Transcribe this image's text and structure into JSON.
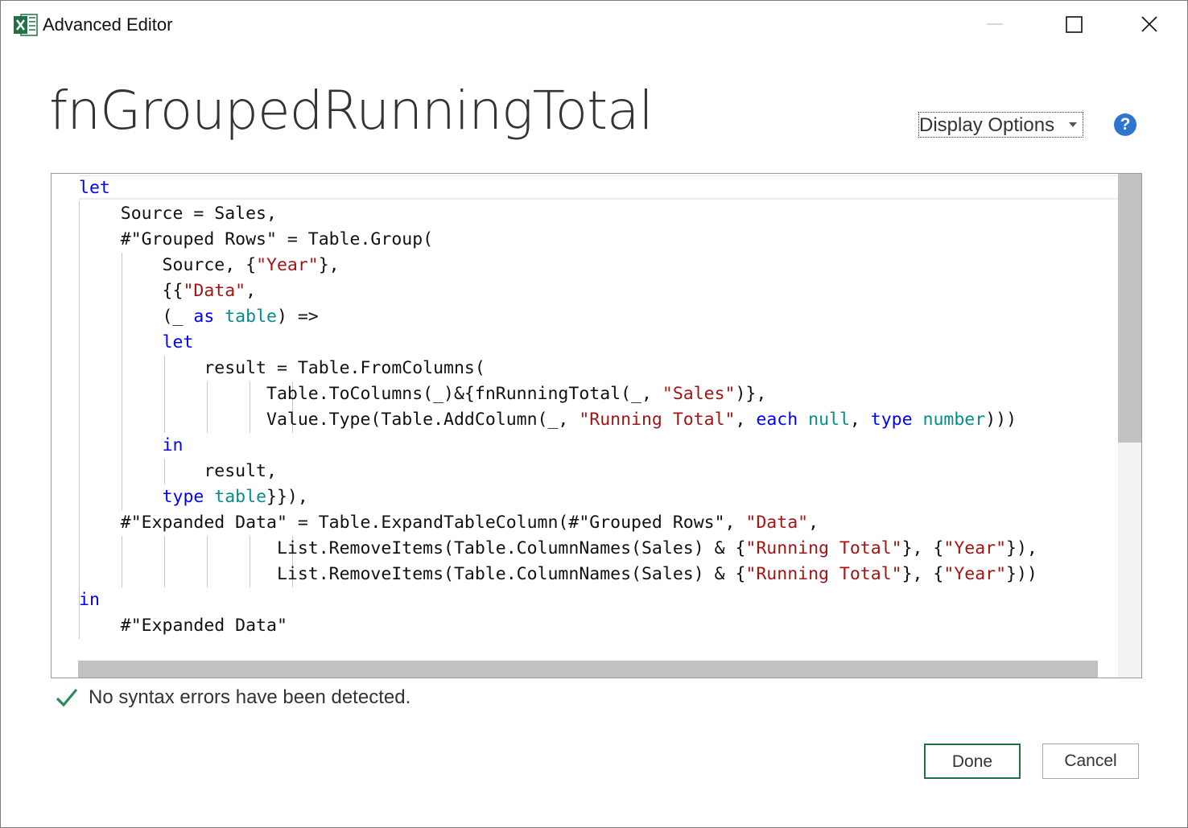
{
  "window": {
    "title": "Advanced Editor",
    "app_icon": "excel-icon",
    "controls": [
      "minimize-icon",
      "maximize-icon",
      "close-icon"
    ]
  },
  "query_name": "fnGroupedRunningTotal",
  "toolbar": {
    "display_options_label": "Display Options",
    "help_label": "?"
  },
  "colors": {
    "keyword": "#0000ff",
    "string": "#a31515",
    "type": "#098b8b",
    "done_border": "#217346",
    "success_check": "#2e8b57"
  },
  "code_lines": [
    [
      {
        "t": "let",
        "c": "kw"
      }
    ],
    [
      {
        "t": "    Source = Sales,"
      }
    ],
    [
      {
        "t": "    #\"Grouped Rows\" = Table.Group("
      }
    ],
    [
      {
        "t": "        Source, {"
      },
      {
        "t": "\"Year\"",
        "c": "st"
      },
      {
        "t": "},"
      }
    ],
    [
      {
        "t": "        {{"
      },
      {
        "t": "\"Data\"",
        "c": "st"
      },
      {
        "t": ","
      }
    ],
    [
      {
        "t": "        (_ "
      },
      {
        "t": "as",
        "c": "kw"
      },
      {
        "t": " "
      },
      {
        "t": "table",
        "c": "ty"
      },
      {
        "t": ") =>"
      }
    ],
    [
      {
        "t": "        "
      },
      {
        "t": "let",
        "c": "kw"
      }
    ],
    [
      {
        "t": "            result = Table.FromColumns("
      }
    ],
    [
      {
        "t": "                  Table.ToColumns(_)&{fnRunningTotal(_, "
      },
      {
        "t": "\"Sales\"",
        "c": "st"
      },
      {
        "t": ")},"
      }
    ],
    [
      {
        "t": "                  Value.Type(Table.AddColumn(_, "
      },
      {
        "t": "\"Running Total\"",
        "c": "st"
      },
      {
        "t": ", "
      },
      {
        "t": "each",
        "c": "kw"
      },
      {
        "t": " "
      },
      {
        "t": "null",
        "c": "ty"
      },
      {
        "t": ", "
      },
      {
        "t": "type",
        "c": "kw"
      },
      {
        "t": " "
      },
      {
        "t": "number",
        "c": "ty"
      },
      {
        "t": ")))"
      }
    ],
    [
      {
        "t": "        "
      },
      {
        "t": "in",
        "c": "kw"
      }
    ],
    [
      {
        "t": "            result,"
      }
    ],
    [
      {
        "t": "        "
      },
      {
        "t": "type",
        "c": "kw"
      },
      {
        "t": " "
      },
      {
        "t": "table",
        "c": "ty"
      },
      {
        "t": "}}),"
      }
    ],
    [
      {
        "t": "    #\"Expanded Data\" = Table.ExpandTableColumn(#\"Grouped Rows\", "
      },
      {
        "t": "\"Data\"",
        "c": "st"
      },
      {
        "t": ","
      }
    ],
    [
      {
        "t": "                   List.RemoveItems(Table.ColumnNames(Sales) & {"
      },
      {
        "t": "\"Running Total\"",
        "c": "st"
      },
      {
        "t": "}, {"
      },
      {
        "t": "\"Year\"",
        "c": "st"
      },
      {
        "t": "}),"
      }
    ],
    [
      {
        "t": "                   List.RemoveItems(Table.ColumnNames(Sales) & {"
      },
      {
        "t": "\"Running Total\"",
        "c": "st"
      },
      {
        "t": "}, {"
      },
      {
        "t": "\"Year\"",
        "c": "st"
      },
      {
        "t": "}))"
      }
    ],
    [
      {
        "t": "in",
        "c": "kw"
      }
    ],
    [
      {
        "t": "    #\"Expanded Data\""
      }
    ]
  ],
  "status": {
    "icon": "checkmark-icon",
    "message": "No syntax errors have been detected."
  },
  "buttons": {
    "done": "Done",
    "cancel": "Cancel"
  }
}
